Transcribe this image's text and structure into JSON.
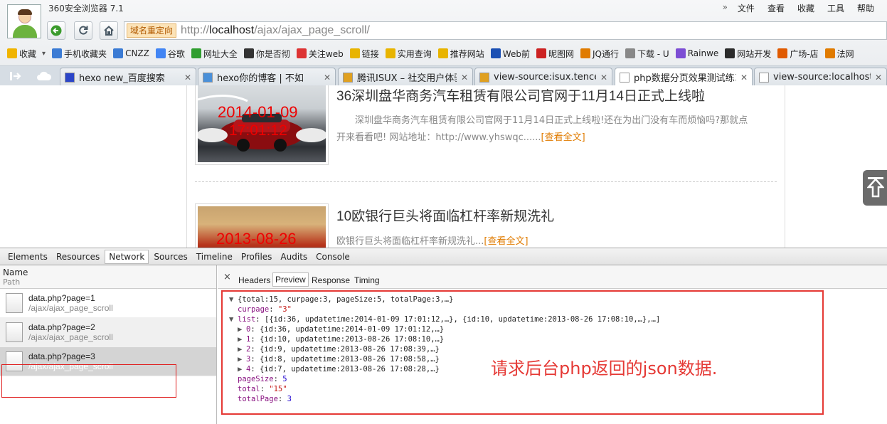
{
  "window": {
    "title": "360安全浏览器 7.1"
  },
  "menu": {
    "arrows": "»",
    "items": [
      "文件",
      "查看",
      "收藏",
      "工具",
      "帮助"
    ]
  },
  "addressbar": {
    "redirect_badge": "域名重定向",
    "url_prefix": "http://",
    "url_host": "localhost",
    "url_path": "/ajax/ajax_page_scroll/"
  },
  "bookmarks": [
    {
      "label": "收藏",
      "icon": "star-plus-icon",
      "color": "#f0b400"
    },
    {
      "label": "手机收藏夹",
      "icon": "phone-icon",
      "color": "#3b7bd4"
    },
    {
      "label": "CNZZ",
      "icon": "bar-chart-icon",
      "color": "#3b7bd4"
    },
    {
      "label": "谷歌",
      "icon": "google-icon",
      "color": "#4285f4"
    },
    {
      "label": "网址大全",
      "icon": "globe-icon",
      "color": "#2f9e2f"
    },
    {
      "label": "你是否彻",
      "icon": "m-icon",
      "color": "#333333"
    },
    {
      "label": "关注web",
      "icon": "weibo-icon",
      "color": "#d33"
    },
    {
      "label": "链接",
      "icon": "folder-icon",
      "color": "#e8b400"
    },
    {
      "label": "实用查询",
      "icon": "folder-icon",
      "color": "#e8b400"
    },
    {
      "label": "推荐网站",
      "icon": "folder-icon",
      "color": "#e8b400"
    },
    {
      "label": "Web前",
      "icon": "w-icon",
      "color": "#1a4fb3"
    },
    {
      "label": "昵图网",
      "icon": "ni-icon",
      "color": "#c22"
    },
    {
      "label": "JQ通行",
      "icon": "jq-icon",
      "color": "#e07b00"
    },
    {
      "label": "下载 - U",
      "icon": "page-icon",
      "color": "#888888"
    },
    {
      "label": "Rainwe",
      "icon": "rain-icon",
      "color": "#7c4dd4"
    },
    {
      "label": "网站开发",
      "icon": "dev-icon",
      "color": "#2b2b2b"
    },
    {
      "label": "广场-店",
      "icon": "shop-icon",
      "color": "#e05a00"
    },
    {
      "label": "法网",
      "icon": "law-icon",
      "color": "#e07b00"
    }
  ],
  "tabs": [
    {
      "label": "hexo new_百度搜索",
      "icon": "baidu-icon"
    },
    {
      "label": "hexo你的博客 | 不如",
      "icon": "burd-icon"
    },
    {
      "label": "腾讯ISUX – 社交用户体验",
      "icon": "isux-icon"
    },
    {
      "label": "view-source:isux.tencent",
      "icon": "isux-icon"
    },
    {
      "label": "php数据分页效果测试练习",
      "icon": "page-icon",
      "active": true
    },
    {
      "label": "view-source:localhost/aj",
      "icon": "page-icon"
    }
  ],
  "articles": [
    {
      "title": "36深圳盘华商务汽车租赁有限公司官网于11月14日正式上线啦",
      "date": "2014-01-09",
      "time": "17:01:12",
      "desc": "深圳盘华商务汽车租赁有限公司官网于11月14日正式上线啦!还在为出门没有车而烦恼吗?那就点开来看看吧!        网站地址：http://www.yhswqc......",
      "more": "[查看全文]"
    },
    {
      "title": "10欧银行巨头将面临杠杆率新规洗礼",
      "date": "2013-08-26",
      "desc": "欧银行巨头将面临杠杆率新规洗礼...",
      "more": "[查看全文]"
    }
  ],
  "devtools": {
    "tabs": [
      "Elements",
      "Resources",
      "Network",
      "Sources",
      "Timeline",
      "Profiles",
      "Audits",
      "Console"
    ],
    "active_tab": "Network",
    "columns": {
      "name": "Name",
      "path": "Path"
    },
    "requests": [
      {
        "name": "data.php?page=1",
        "path": "/ajax/ajax_page_scroll"
      },
      {
        "name": "data.php?page=2",
        "path": "/ajax/ajax_page_scroll"
      },
      {
        "name": "data.php?page=3",
        "path": "/ajax/ajax_page_scroll",
        "selected": true
      }
    ],
    "subtabs": [
      "Headers",
      "Preview",
      "Response",
      "Timing"
    ],
    "active_subtab": "Preview",
    "close": "×",
    "json_lines": [
      {
        "tri": "▼",
        "text": "{total:15, curpage:3, pageSize:5, totalPage:3,…}"
      },
      {
        "tri": "",
        "key": "curpage",
        "val": "\"3\"",
        "type": "s"
      },
      {
        "tri": "▼",
        "key": "list",
        "val": "[{id:36, updatetime:2014-01-09 17:01:12,…}, {id:10, updatetime:2013-08-26 17:08:10,…},…]",
        "type": "plain"
      },
      {
        "tri": "▶",
        "indent": 1,
        "key": "0",
        "val": "{id:36, updatetime:2014-01-09 17:01:12,…}",
        "type": "plain"
      },
      {
        "tri": "▶",
        "indent": 1,
        "key": "1",
        "val": "{id:10, updatetime:2013-08-26 17:08:10,…}",
        "type": "plain"
      },
      {
        "tri": "▶",
        "indent": 1,
        "key": "2",
        "val": "{id:9, updatetime:2013-08-26 17:08:39,…}",
        "type": "plain"
      },
      {
        "tri": "▶",
        "indent": 1,
        "key": "3",
        "val": "{id:8, updatetime:2013-08-26 17:08:58,…}",
        "type": "plain"
      },
      {
        "tri": "▶",
        "indent": 1,
        "key": "4",
        "val": "{id:7, updatetime:2013-08-26 17:08:28,…}",
        "type": "plain"
      },
      {
        "tri": "",
        "key": "pageSize",
        "val": "5",
        "type": "num"
      },
      {
        "tri": "",
        "key": "total",
        "val": "\"15\"",
        "type": "s"
      },
      {
        "tri": "",
        "key": "totalPage",
        "val": "3",
        "type": "num"
      }
    ],
    "annotation": "请求后台php返回的json数据."
  }
}
